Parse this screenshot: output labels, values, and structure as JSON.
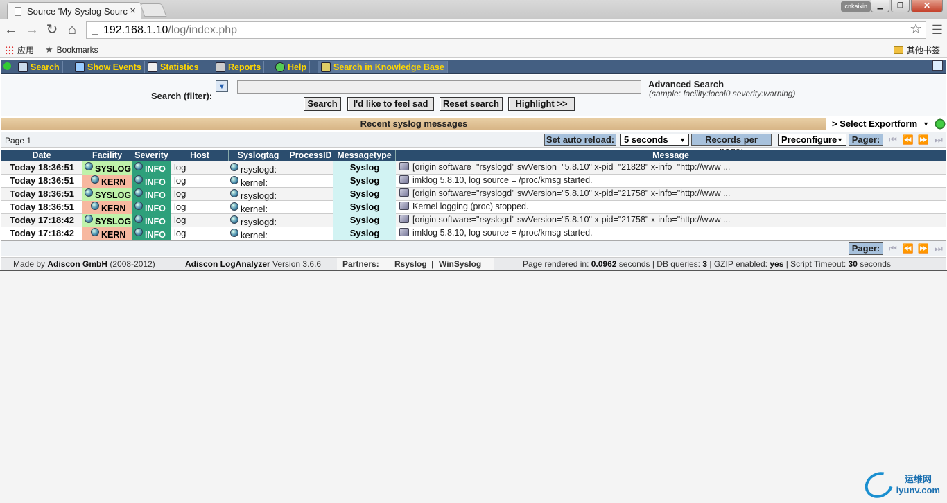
{
  "browser": {
    "tab_title": "Source 'My Syslog Sourc",
    "tab_close": "×",
    "user_badge": "cnkaixin",
    "url_host": "192.168.1.10",
    "url_path": "/log/index.php",
    "bookmarks": {
      "apps": "应用",
      "bookmarks": "Bookmarks",
      "other": "其他书签"
    }
  },
  "nav": {
    "items": [
      {
        "label": "Search"
      },
      {
        "label": "Show Events"
      },
      {
        "label": "Statistics"
      },
      {
        "label": "Reports"
      },
      {
        "label": "Help"
      },
      {
        "label": "Search in Knowledge Base"
      }
    ]
  },
  "search": {
    "label": "Search (filter):",
    "value": "",
    "buttons": {
      "search": "Search",
      "feel_sad": "I'd like to feel sad",
      "reset": "Reset search",
      "highlight": "Highlight >>"
    },
    "advanced_title": "Advanced Search",
    "advanced_sample": "(sample: facility:local0 severity:warning)"
  },
  "messages_title": "Recent syslog messages",
  "export_select": "> Select Exportform",
  "pager": {
    "page_label": "Page 1",
    "auto_reload_label": "Set auto reload:",
    "auto_reload_value": "5 seconds",
    "records_label": "Records per page:",
    "records_value": "Preconfigured",
    "pager_label": "Pager:"
  },
  "table": {
    "columns": [
      "Date",
      "Facility",
      "Severity",
      "Host",
      "Syslogtag",
      "ProcessID",
      "Messagetype",
      "Message"
    ],
    "rows": [
      {
        "date": "Today 18:36:51",
        "facility": "SYSLOG",
        "severity": "INFO",
        "host": "log",
        "tag": "rsyslogd:",
        "pid": "",
        "type": "Syslog",
        "message": "[origin software=\"rsyslogd\" swVersion=\"5.8.10\" x-pid=\"21828\" x-info=\"http://www ..."
      },
      {
        "date": "Today 18:36:51",
        "facility": "KERN",
        "severity": "INFO",
        "host": "log",
        "tag": "kernel:",
        "pid": "",
        "type": "Syslog",
        "message": "imklog 5.8.10, log source = /proc/kmsg started."
      },
      {
        "date": "Today 18:36:51",
        "facility": "SYSLOG",
        "severity": "INFO",
        "host": "log",
        "tag": "rsyslogd:",
        "pid": "",
        "type": "Syslog",
        "message": "[origin software=\"rsyslogd\" swVersion=\"5.8.10\" x-pid=\"21758\" x-info=\"http://www ..."
      },
      {
        "date": "Today 18:36:51",
        "facility": "KERN",
        "severity": "INFO",
        "host": "log",
        "tag": "kernel:",
        "pid": "",
        "type": "Syslog",
        "message": "Kernel logging (proc) stopped."
      },
      {
        "date": "Today 17:18:42",
        "facility": "SYSLOG",
        "severity": "INFO",
        "host": "log",
        "tag": "rsyslogd:",
        "pid": "",
        "type": "Syslog",
        "message": "[origin software=\"rsyslogd\" swVersion=\"5.8.10\" x-pid=\"21758\" x-info=\"http://www ..."
      },
      {
        "date": "Today 17:18:42",
        "facility": "KERN",
        "severity": "INFO",
        "host": "log",
        "tag": "kernel:",
        "pid": "",
        "type": "Syslog",
        "message": "imklog 5.8.10, log source = /proc/kmsg started."
      }
    ]
  },
  "footer": {
    "made_by_prefix": "Made by",
    "company": "Adiscon GmbH",
    "years": "(2008-2012)",
    "product": "Adiscon LogAnalyzer",
    "version": "Version 3.6.6",
    "partners_label": "Partners:",
    "partner1": "Rsyslog",
    "partner2": "WinSyslog",
    "rendered_label": "Page rendered in:",
    "rendered_value": "0.0962",
    "rendered_unit": "seconds",
    "db_label": "| DB queries:",
    "db_value": "3",
    "gzip_label": "| GZIP enabled:",
    "gzip_value": "yes",
    "timeout_label": "| Script Timeout:",
    "timeout_value": "30",
    "timeout_unit": "seconds"
  },
  "watermark": {
    "cn": "运维网",
    "domain": "iyunv.com"
  },
  "colors": {
    "nav_bg": "#445f82",
    "nav_text": "#ffd700",
    "syslog_bg": "#bff2aa",
    "kern_bg": "#f7b8a0",
    "info_bg": "#2ea07b",
    "header_bg": "#2b4d6e"
  }
}
